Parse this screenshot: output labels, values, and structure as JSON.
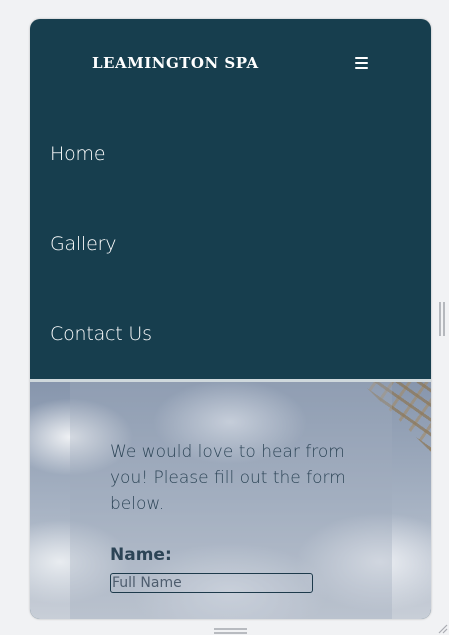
{
  "header": {
    "brand": "LEAMINGTON SPA",
    "menu_icon": "hamburger-menu-icon"
  },
  "nav": {
    "items": [
      "Home",
      "Gallery",
      "Contact Us"
    ]
  },
  "contact": {
    "intro": "We would love to hear from you! Please fill out the form below.",
    "name_label": "Name:",
    "name_placeholder": "Full Name"
  },
  "colors": {
    "header_bg": "#173e4e",
    "text_dark": "#2c4456",
    "nav_text": "#ffffff"
  }
}
